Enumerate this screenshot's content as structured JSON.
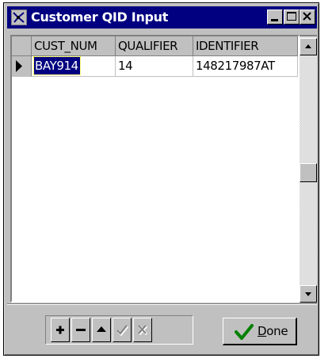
{
  "window": {
    "title": "Customer QID Input"
  },
  "titlebar_buttons": {
    "minimize": "minimize-icon",
    "maximize": "maximize-icon",
    "close": "close-icon"
  },
  "grid": {
    "columns": [
      "CUST_NUM",
      "QUALIFIER",
      "IDENTIFIER"
    ],
    "rows": [
      {
        "CUST_NUM": "BAY914",
        "QUALIFIER": "14",
        "IDENTIFIER": "148217987AT",
        "current": true
      }
    ]
  },
  "navigator": {
    "buttons": [
      {
        "name": "insert",
        "icon": "plus-icon",
        "enabled": true
      },
      {
        "name": "delete",
        "icon": "minus-icon",
        "enabled": true
      },
      {
        "name": "edit",
        "icon": "up-arrow-icon",
        "enabled": true
      },
      {
        "name": "post",
        "icon": "checkmark-icon",
        "enabled": false
      },
      {
        "name": "cancel",
        "icon": "x-icon",
        "enabled": false
      }
    ]
  },
  "done_button": {
    "label": "Done",
    "icon": "green-check-icon"
  },
  "colors": {
    "titlebar": "#000080",
    "face": "#c0c0c0",
    "selection": "#000080",
    "done_check": "#008000"
  }
}
